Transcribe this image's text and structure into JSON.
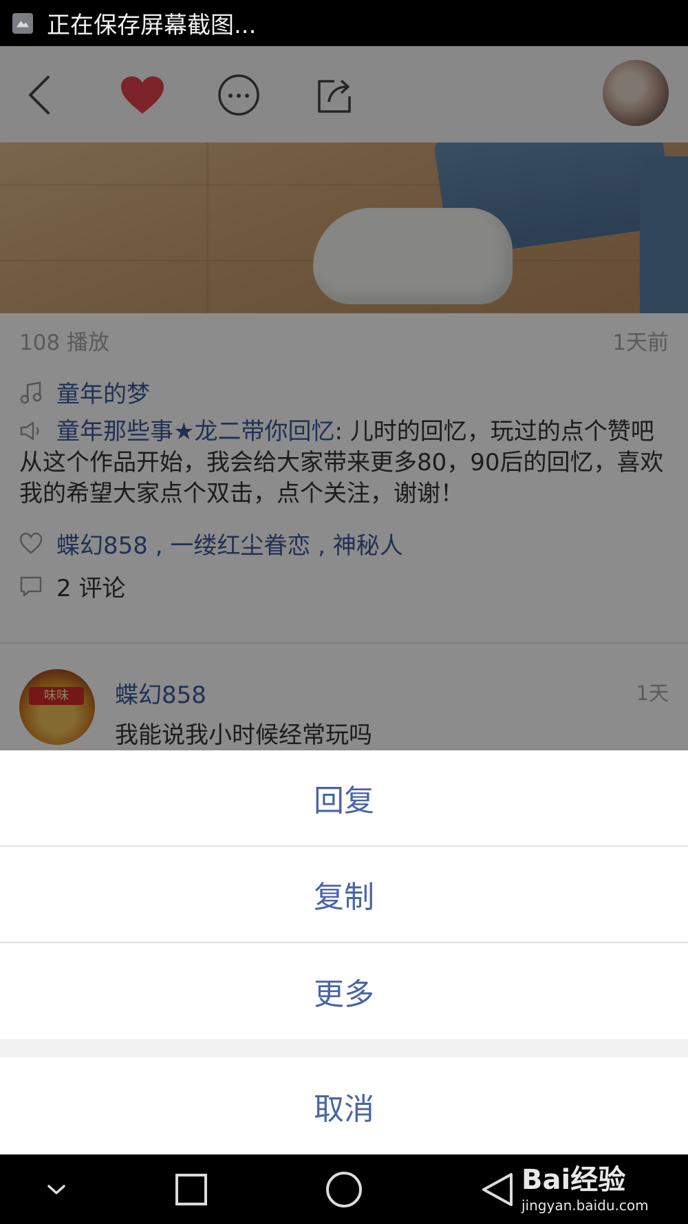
{
  "status_bar": {
    "text": "正在保存屏幕截图..."
  },
  "topbar": {
    "back_icon": "chevron-left-icon",
    "like_icon": "heart-icon",
    "more_icon": "ellipsis-circle-icon",
    "share_icon": "share-icon",
    "like_color": "#e2434b"
  },
  "post": {
    "plays": "108 播放",
    "time": "1天前",
    "music": "童年的梦",
    "title_link": "童年那些事★龙二带你回忆",
    "title_rest": ": 儿时的回忆，玩过的点个赞吧",
    "description": "从这个作品开始，我会给大家带来更多80，90后的回忆，喜欢我的希望大家点个双击，点个关注，谢谢！",
    "likers": "蝶幻858 , 一缕红尘眷恋 , 神秘人",
    "comment_count": "2 评论"
  },
  "comment": {
    "username": "蝶幻858",
    "time": "1天",
    "text": "我能说我小时候经常玩吗",
    "avatar_label": "味味"
  },
  "action_sheet": {
    "reply": "回复",
    "copy": "复制",
    "more": "更多",
    "cancel": "取消",
    "text_color": "#4a64a6"
  },
  "nav_bar": {
    "hide_icon": "chevron-down-icon",
    "recents_icon": "square-icon",
    "home_icon": "circle-icon",
    "back_icon": "triangle-back-icon"
  },
  "watermark": {
    "logo": "Bai经验",
    "url": "jingyan.baidu.com"
  }
}
